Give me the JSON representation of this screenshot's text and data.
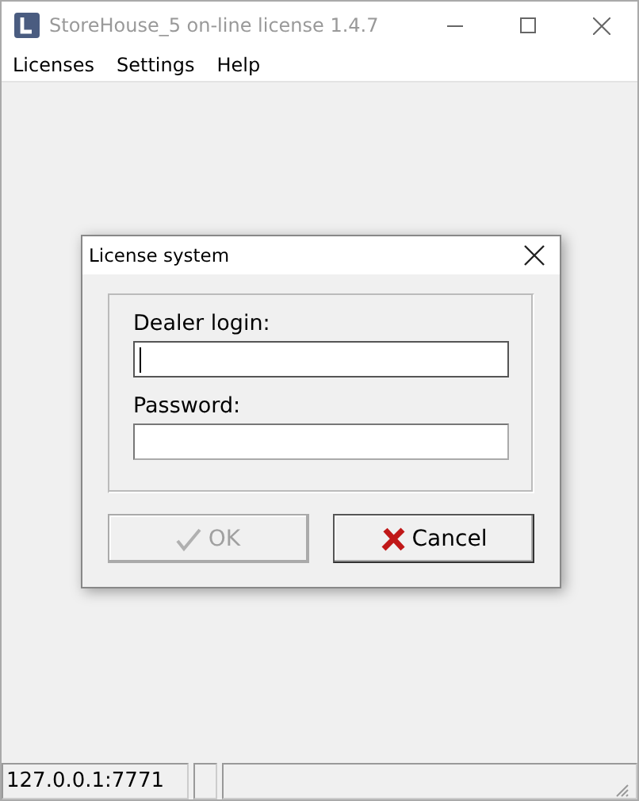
{
  "window": {
    "title": "StoreHouse_5 on-line license 1.4.7"
  },
  "menu": [
    "Licenses",
    "Settings",
    "Help"
  ],
  "dialog": {
    "title": "License system",
    "fields": [
      {
        "label": "Dealer login:",
        "focused": true
      },
      {
        "label": "Password:",
        "focused": false
      }
    ],
    "buttons": [
      {
        "label": "OK",
        "kind": "ok",
        "disabled": true
      },
      {
        "label": "Cancel",
        "kind": "cancel",
        "disabled": false
      }
    ]
  },
  "status_bar": [
    "127.0.0.1:7771"
  ]
}
